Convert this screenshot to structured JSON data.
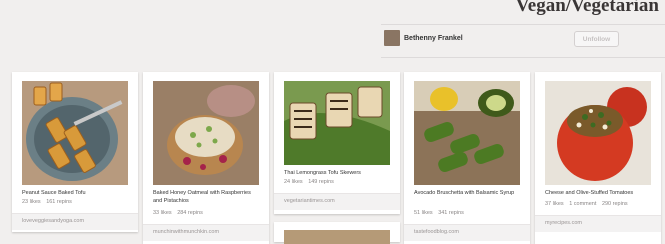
{
  "board": {
    "title": "Vegan/Vegetarian"
  },
  "owner": {
    "name": "Bethenny Frankel",
    "action_label": "Unfollow"
  },
  "pins": [
    {
      "description": "Peanut Sauce Baked Tofu",
      "likes": "23 likes",
      "comments": "",
      "repins": "161 repins",
      "source": "loveveggiesandyoga.com"
    },
    {
      "description": "Baked Honey Oatmeal with Raspberries and Pistachios",
      "likes": "33 likes",
      "comments": "",
      "repins": "284 repins",
      "source": "munchinwithmunchkin.com"
    },
    {
      "description": "Thai Lemongrass Tofu Skewers",
      "likes": "24 likes",
      "comments": "",
      "repins": "149 repins",
      "source": "vegetariantimes.com"
    },
    {
      "description": "Avocado Bruschetta with Balsamic Syrup",
      "likes": "51 likes",
      "comments": "",
      "repins": "341 repins",
      "source": "tastefoodblog.com"
    },
    {
      "description": "Cheese and Olive-Stuffed Tomatoes",
      "likes": "37 likes",
      "comments": "1 comment",
      "repins": "290 repins",
      "source": "myrecipes.com"
    }
  ]
}
